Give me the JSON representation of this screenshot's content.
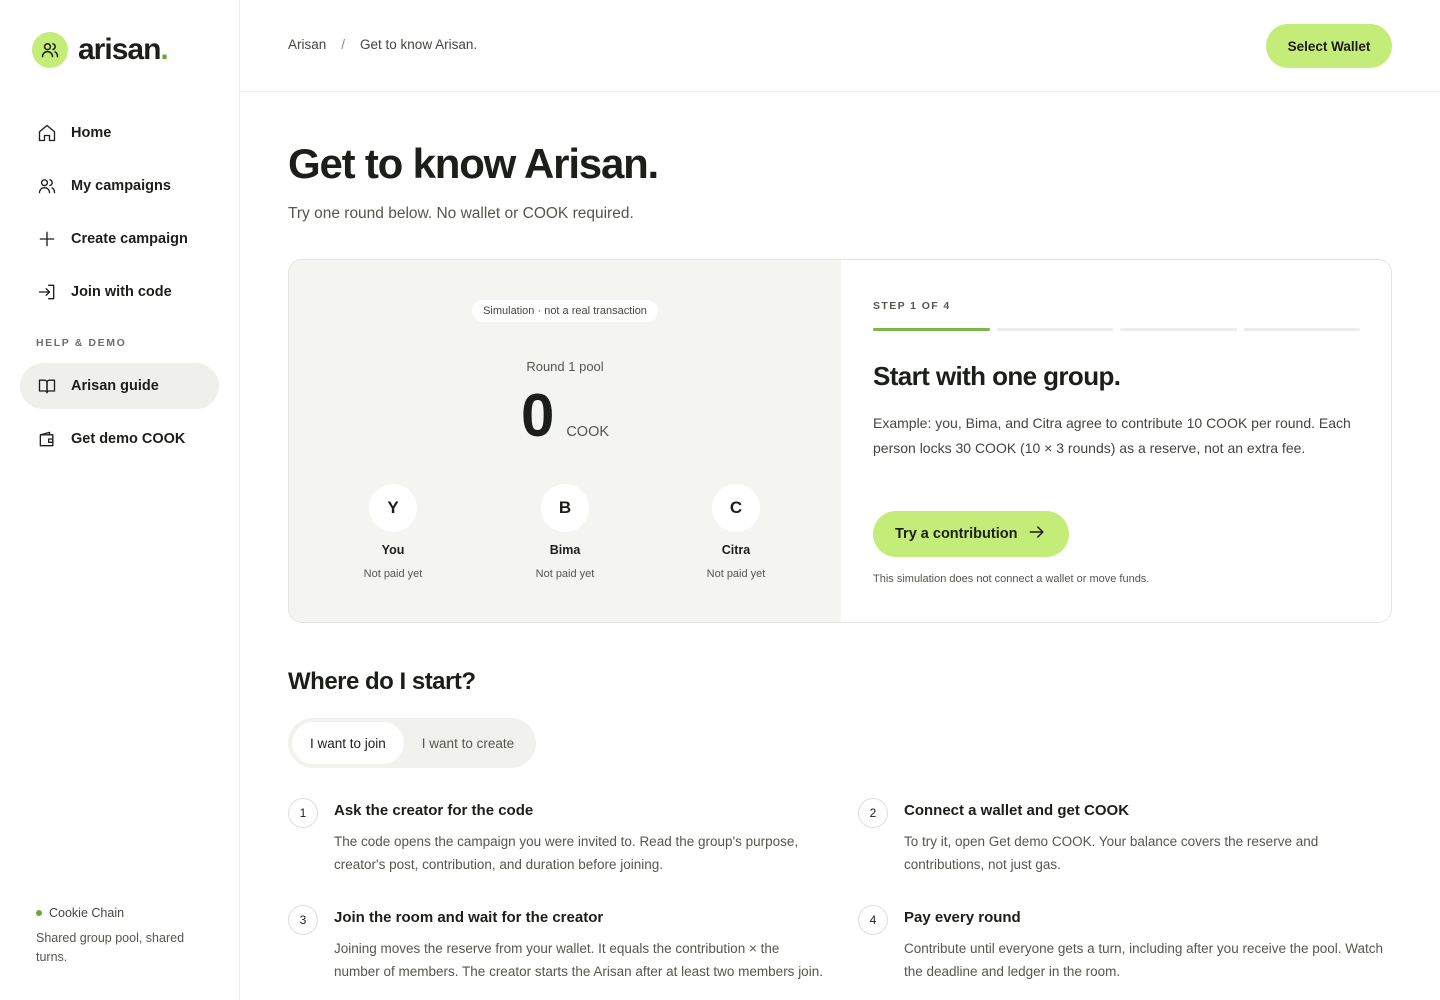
{
  "app": {
    "logo_text": "arisan",
    "logo_dot": ".",
    "accent_color": "#c3ec78"
  },
  "sidebar": {
    "items": [
      {
        "label": "Home",
        "icon": "home-icon"
      },
      {
        "label": "My campaigns",
        "icon": "users-icon"
      },
      {
        "label": "Create campaign",
        "icon": "plus-icon"
      },
      {
        "label": "Join with code",
        "icon": "sign-in-icon"
      }
    ],
    "section_label": "HELP & DEMO",
    "help_items": [
      {
        "label": "Arisan guide",
        "icon": "book-icon",
        "active": true
      },
      {
        "label": "Get demo COOK",
        "icon": "wallet-icon"
      }
    ],
    "chain_name": "Cookie Chain",
    "chain_desc": "Shared group pool, shared turns."
  },
  "header": {
    "breadcrumbs": [
      "Arisan",
      "Get to know Arisan."
    ],
    "breadcrumb_sep": "/",
    "wallet_button": "Select Wallet"
  },
  "page": {
    "title": "Get to know Arisan.",
    "subtitle": "Try one round below. No wallet or COOK required."
  },
  "simulation": {
    "badge": "Simulation · not a real transaction",
    "round_label": "Round 1 pool",
    "pool_amount": "0",
    "pool_unit": "COOK",
    "members": [
      {
        "initial": "Y",
        "name": "You",
        "status": "Not paid yet"
      },
      {
        "initial": "B",
        "name": "Bima",
        "status": "Not paid yet"
      },
      {
        "initial": "C",
        "name": "Citra",
        "status": "Not paid yet"
      }
    ],
    "step_label": "STEP 1 OF 4",
    "step_progress": 0.25,
    "step_title": "Start with one group.",
    "step_desc": "Example: you, Bima, and Citra agree to contribute 10 COOK per round. Each person locks 30 COOK (10 × 3 rounds) as a reserve, not an extra fee.",
    "try_button": "Try a contribution",
    "note": "This simulation does not connect a wallet or move funds."
  },
  "start": {
    "title": "Where do I start?",
    "tabs": [
      {
        "label": "I want to join",
        "active": true
      },
      {
        "label": "I want to create",
        "active": false
      }
    ],
    "steps": [
      {
        "num": "1",
        "title": "Ask the creator for the code",
        "desc": "The code opens the campaign you were invited to. Read the group's purpose, creator's post, contribution, and duration before joining."
      },
      {
        "num": "2",
        "title": "Connect a wallet and get COOK",
        "desc": "To try it, open Get demo COOK. Your balance covers the reserve and contributions, not just gas."
      },
      {
        "num": "3",
        "title": "Join the room and wait for the creator",
        "desc": "Joining moves the reserve from your wallet. It equals the contribution × the number of members. The creator starts the Arisan after at least two members join."
      },
      {
        "num": "4",
        "title": "Pay every round",
        "desc": "Contribute until everyone gets a turn, including after you receive the pool. Watch the deadline and ledger in the room."
      }
    ]
  }
}
